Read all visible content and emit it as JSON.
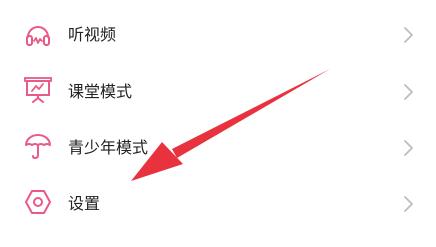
{
  "colors": {
    "icon_accent": "#e95a86",
    "chevron": "#bdbdbd",
    "label": "#222222",
    "annotation_arrow": "#e8333f"
  },
  "menu": {
    "items": [
      {
        "label": "听视频",
        "icon": "headphones-icon"
      },
      {
        "label": "课堂模式",
        "icon": "presentation-board-icon"
      },
      {
        "label": "青少年模式",
        "icon": "umbrella-icon"
      },
      {
        "label": "设置",
        "icon": "settings-hexagon-icon"
      }
    ]
  }
}
